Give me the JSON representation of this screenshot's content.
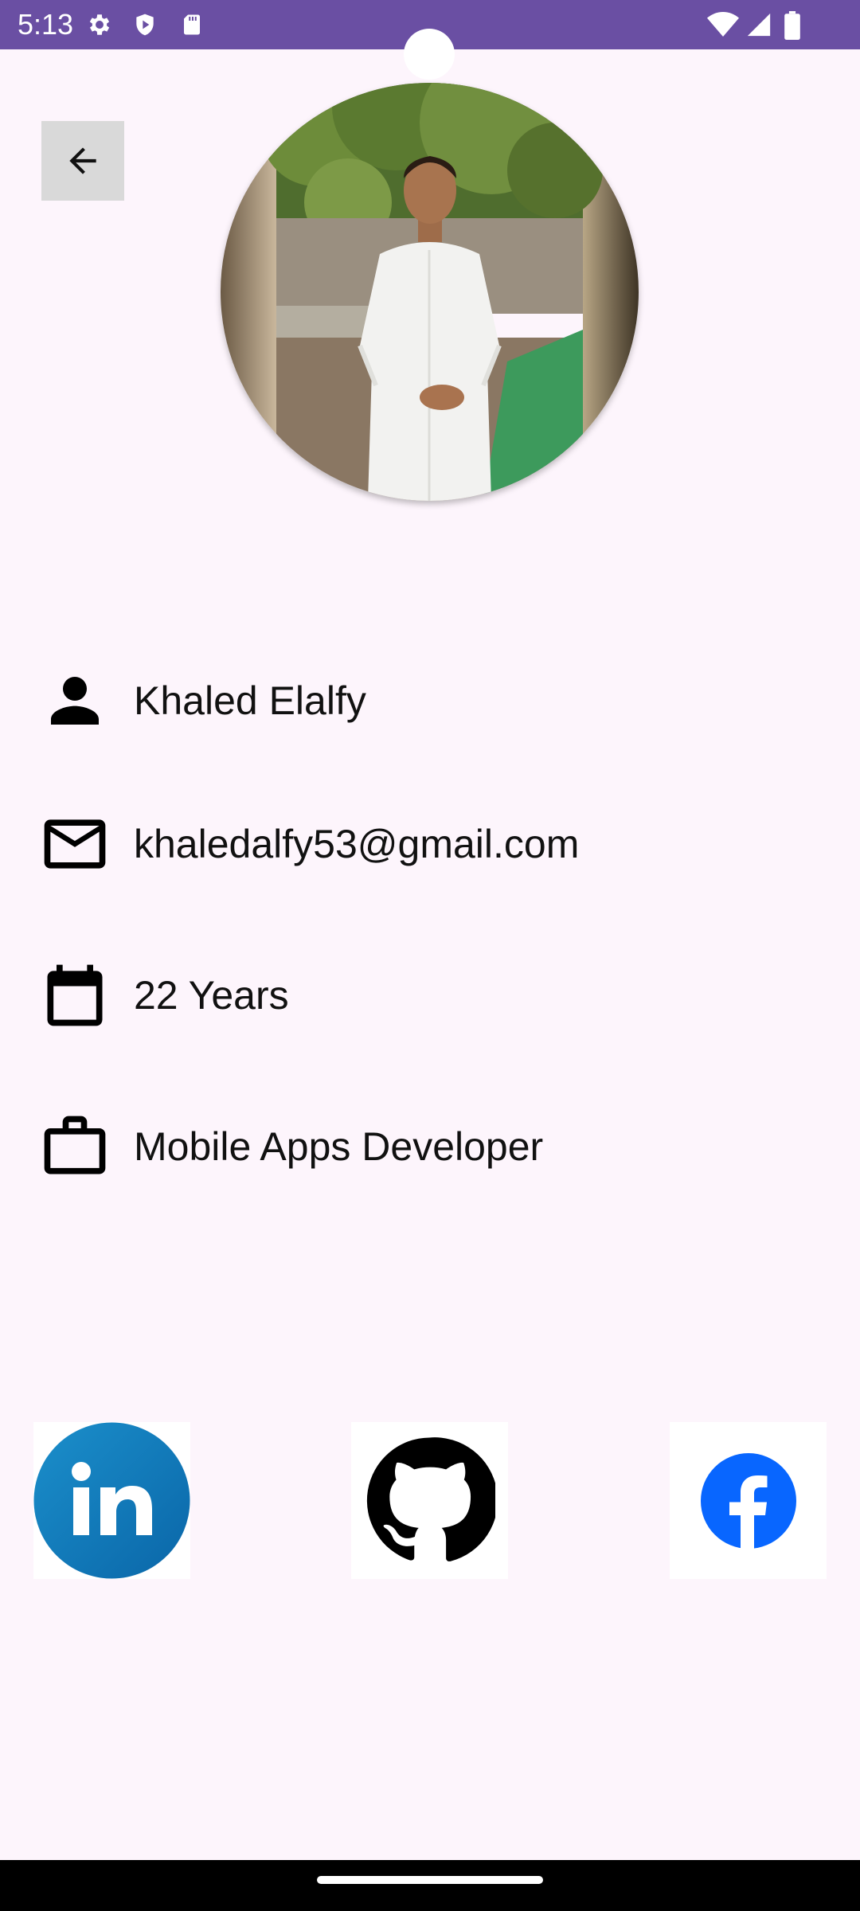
{
  "status_bar": {
    "time": "5:13",
    "left_icons": [
      "settings-icon",
      "shield-icon",
      "sd-card-icon"
    ],
    "right_icons": [
      "wifi-icon",
      "signal-icon",
      "battery-icon"
    ],
    "color": "#6A4FA3"
  },
  "header": {
    "back_icon": "arrow-back-icon"
  },
  "profile": {
    "photo": "profile-photo",
    "name": "Khaled Elalfy",
    "email": "khaledalfy53@gmail.com",
    "age": "22 Years",
    "job": "Mobile Apps Developer"
  },
  "social": {
    "items": [
      {
        "icon": "linkedin-icon",
        "label": "in",
        "color": "#0E76A8"
      },
      {
        "icon": "github-icon",
        "color": "#000000"
      },
      {
        "icon": "facebook-icon",
        "label": "f",
        "color": "#0866FF"
      }
    ]
  },
  "colors": {
    "background": "#FDF5FC",
    "back_button": "#D9D9D9"
  }
}
